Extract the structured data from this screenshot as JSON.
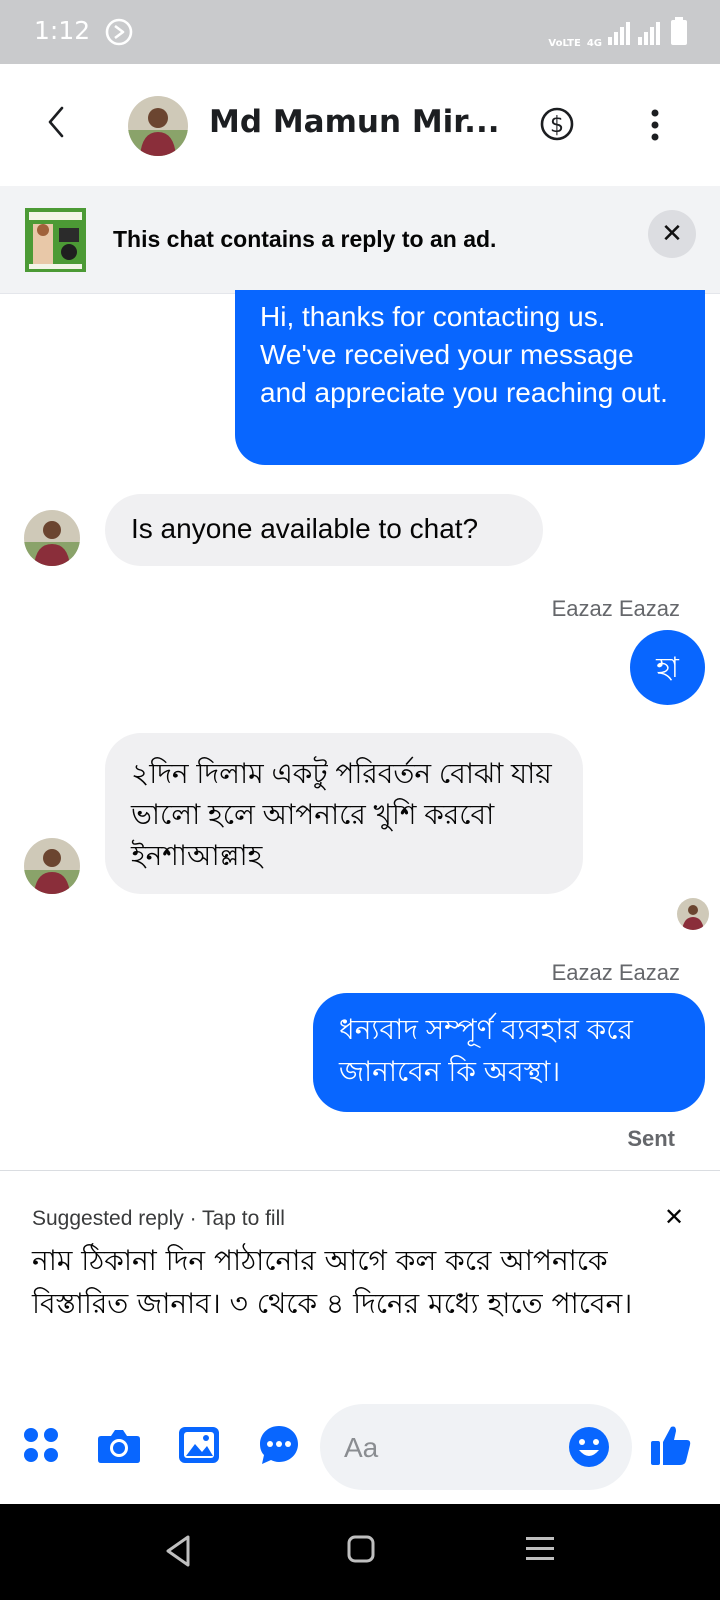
{
  "status_bar": {
    "time": "1:12",
    "network_label": "VoLTE",
    "network_type": "4G"
  },
  "header": {
    "contact_name": "Md Mamun Mir...",
    "back_icon": "chevron-left-icon",
    "payment_icon": "dollar-circle-icon",
    "more_icon": "more-vertical-icon"
  },
  "ad_banner": {
    "text": "This chat contains a reply to an ad.",
    "close_label": "✕"
  },
  "messages": [
    {
      "direction": "outgoing",
      "text": "Hi, thanks for contacting us. We've received your message and appreciate you reaching out."
    },
    {
      "direction": "incoming",
      "text": "Is anyone available to chat?"
    },
    {
      "direction": "outgoing",
      "sender": "Eazaz Eazaz",
      "text": "হা"
    },
    {
      "direction": "incoming",
      "text": "২দিন দিলাম একটু পরিবর্তন বোঝা যায় ভালো হলে আপনারে খুশি করবো ইনশাআল্লাহ"
    },
    {
      "direction": "outgoing",
      "sender": "Eazaz Eazaz",
      "text": "ধন্যবাদ সম্পূর্ণ ব্যবহার করে জানাবেন কি অবস্থা।"
    }
  ],
  "message_status": "Sent",
  "suggested_reply": {
    "header": "Suggested reply · Tap to fill",
    "close_label": "✕",
    "text": "নাম ঠিকানা দিন পাঠানোর আগে কল করে আপনাকে বিস্তারিত জানাব। ৩ থেকে ৪ দিনের মধ্যে হাতে পাবেন।"
  },
  "composer": {
    "placeholder": "Aa",
    "accent_color": "#0866ff"
  },
  "colors": {
    "outgoing_bubble": "#0866ff",
    "incoming_bubble": "#f0f0f2",
    "status_bar": "#c9cacc"
  }
}
